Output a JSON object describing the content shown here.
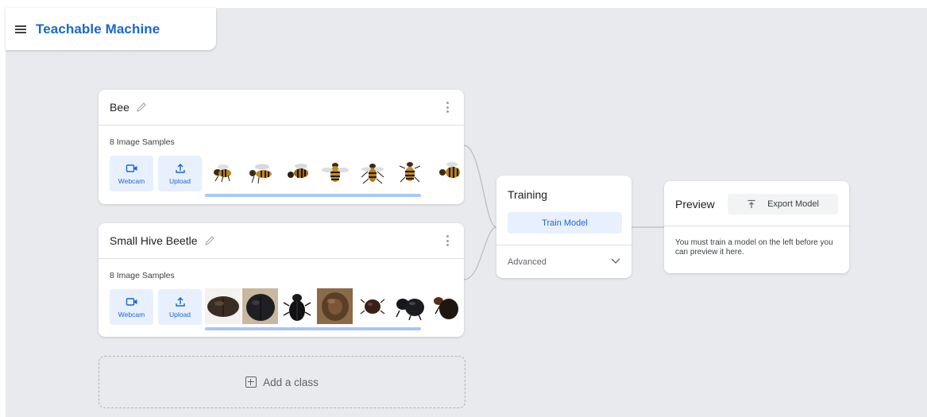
{
  "app": {
    "title": "Teachable Machine"
  },
  "classes": [
    {
      "name": "Bee",
      "samples_label": "8 Image Samples",
      "webcam_label": "Webcam",
      "upload_label": "Upload",
      "thumbnails": [
        "bee-thumbnail",
        "bee-thumbnail",
        "bee-thumbnail",
        "bee-thumbnail",
        "bee-thumbnail",
        "bee-thumbnail",
        "bee-thumbnail"
      ]
    },
    {
      "name": "Small Hive Beetle",
      "samples_label": "8 Image Samples",
      "webcam_label": "Webcam",
      "upload_label": "Upload",
      "thumbnails": [
        "beetle-thumbnail",
        "beetle-thumbnail",
        "beetle-thumbnail",
        "beetle-thumbnail",
        "beetle-thumbnail",
        "beetle-thumbnail",
        "beetle-thumbnail"
      ]
    }
  ],
  "add_class": {
    "label": "Add a class"
  },
  "training": {
    "title": "Training",
    "train_button": "Train Model",
    "advanced_label": "Advanced"
  },
  "preview": {
    "title": "Preview",
    "export_button": "Export Model",
    "message": "You must train a model on the left before you can preview it here."
  },
  "colors": {
    "accent": "#1967d2",
    "accent_light": "#e8f0fe",
    "canvas": "#e8eaed"
  }
}
